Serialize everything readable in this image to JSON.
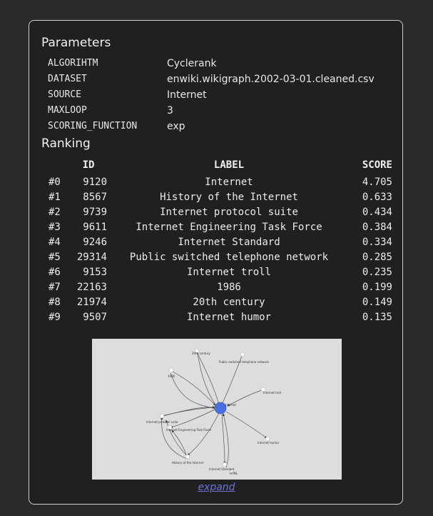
{
  "parameters": {
    "title": "Parameters",
    "rows": [
      {
        "key": "ALGORIHTM",
        "value": "Cyclerank"
      },
      {
        "key": "DATASET",
        "value": "enwiki.wikigraph.2002-03-01.cleaned.csv"
      },
      {
        "key": "SOURCE",
        "value": "Internet"
      },
      {
        "key": "MAXLOOP",
        "value": "3"
      },
      {
        "key": "SCORING_FUNCTION",
        "value": "exp"
      }
    ]
  },
  "ranking": {
    "title": "Ranking",
    "columns": {
      "rank": "",
      "id": "ID",
      "label": "LABEL",
      "score": "SCORE"
    },
    "rows": [
      {
        "rank": "#0",
        "id": "9120",
        "label": "Internet",
        "score": "4.705"
      },
      {
        "rank": "#1",
        "id": "8567",
        "label": "History of the Internet",
        "score": "0.633"
      },
      {
        "rank": "#2",
        "id": "9739",
        "label": "Internet protocol suite",
        "score": "0.434"
      },
      {
        "rank": "#3",
        "id": "9611",
        "label": "Internet Engineering Task Force",
        "score": "0.384"
      },
      {
        "rank": "#4",
        "id": "9246",
        "label": "Internet Standard",
        "score": "0.334"
      },
      {
        "rank": "#5",
        "id": "29314",
        "label": "Public switched telephone network",
        "score": "0.285"
      },
      {
        "rank": "#6",
        "id": "9153",
        "label": "Internet troll",
        "score": "0.235"
      },
      {
        "rank": "#7",
        "id": "22163",
        "label": "1986",
        "score": "0.199"
      },
      {
        "rank": "#8",
        "id": "21974",
        "label": "20th century",
        "score": "0.149"
      },
      {
        "rank": "#9",
        "id": "9507",
        "label": "Internet humor",
        "score": "0.135"
      }
    ]
  },
  "graph": {
    "background": "#dddddd",
    "center_color": "#4a6fe0",
    "node_labels": {
      "century": "20th century",
      "pstn": "Public switched telephone network",
      "y1986": "1986",
      "internet": "Internet",
      "troll": "Internet troll",
      "protocol": "Internet protocol suite",
      "ietf": "Internet Engineering Task Force",
      "humor": "Internet humor",
      "history": "History of the Internet",
      "standard": "Internet Standard",
      "html": "HTML"
    }
  },
  "expand_link": "expand",
  "colors": {
    "page_bg": "#2a2a2a",
    "card_bg": "#202020",
    "card_border": "#cfcfcf",
    "text": "#e6e6e6",
    "link": "#6f73d6"
  }
}
